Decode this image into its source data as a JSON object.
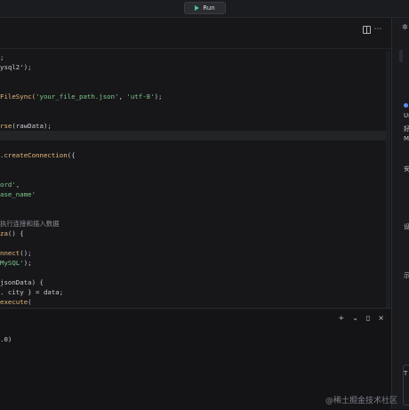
{
  "toolbar": {
    "run_label": "Run"
  },
  "editor": {
    "lines": [
      [
        {
          "t": "l",
          "c": ";"
        }
      ],
      [
        {
          "t": "p",
          "c": "ysql2');"
        }
      ],
      [],
      [],
      [
        {
          "t": "f",
          "c": "FileSync("
        },
        {
          "t": "s",
          "c": "'your_file_path.json'"
        },
        {
          "t": "p",
          "c": ", "
        },
        {
          "t": "s",
          "c": "'utf-8'"
        },
        {
          "t": "p",
          "c": ");"
        }
      ],
      [],
      [],
      [
        {
          "t": "f",
          "c": "rse"
        },
        {
          "t": "p",
          "c": "(rawData);"
        }
      ],
      [],
      [],
      [
        {
          "t": "p",
          "c": "."
        },
        {
          "t": "f",
          "c": "createConnection"
        },
        {
          "t": "p",
          "c": "({"
        }
      ],
      [],
      [],
      [
        {
          "t": "s",
          "c": "ord'"
        },
        {
          "t": "p",
          "c": ","
        }
      ],
      [
        {
          "t": "s",
          "c": "ase_name'"
        }
      ],
      [],
      [],
      [
        {
          "t": "c",
          "c": "执行连接和插入数据"
        }
      ],
      [
        {
          "t": "f",
          "c": "za"
        },
        {
          "t": "p",
          "c": "() {"
        }
      ],
      [],
      [
        {
          "t": "f",
          "c": "nnect"
        },
        {
          "t": "p",
          "c": "();"
        }
      ],
      [
        {
          "t": "s",
          "c": "MySQL'"
        },
        {
          "t": "p",
          "c": ");"
        }
      ],
      [],
      [
        {
          "t": "p",
          "c": "jsonData) {"
        }
      ],
      [
        {
          "t": "p",
          "c": ". city } = data;"
        }
      ],
      [
        {
          "t": "f",
          "c": "execute"
        },
        {
          "t": "p",
          "c": "("
        }
      ]
    ],
    "highlighted_line": 8
  },
  "terminal": {
    "output": ".0)"
  },
  "right_panel": {
    "items": [
      "Ur",
      "好",
      "M",
      "安",
      "设",
      "示",
      "T"
    ]
  },
  "watermark": "@稀土掘金技术社区"
}
